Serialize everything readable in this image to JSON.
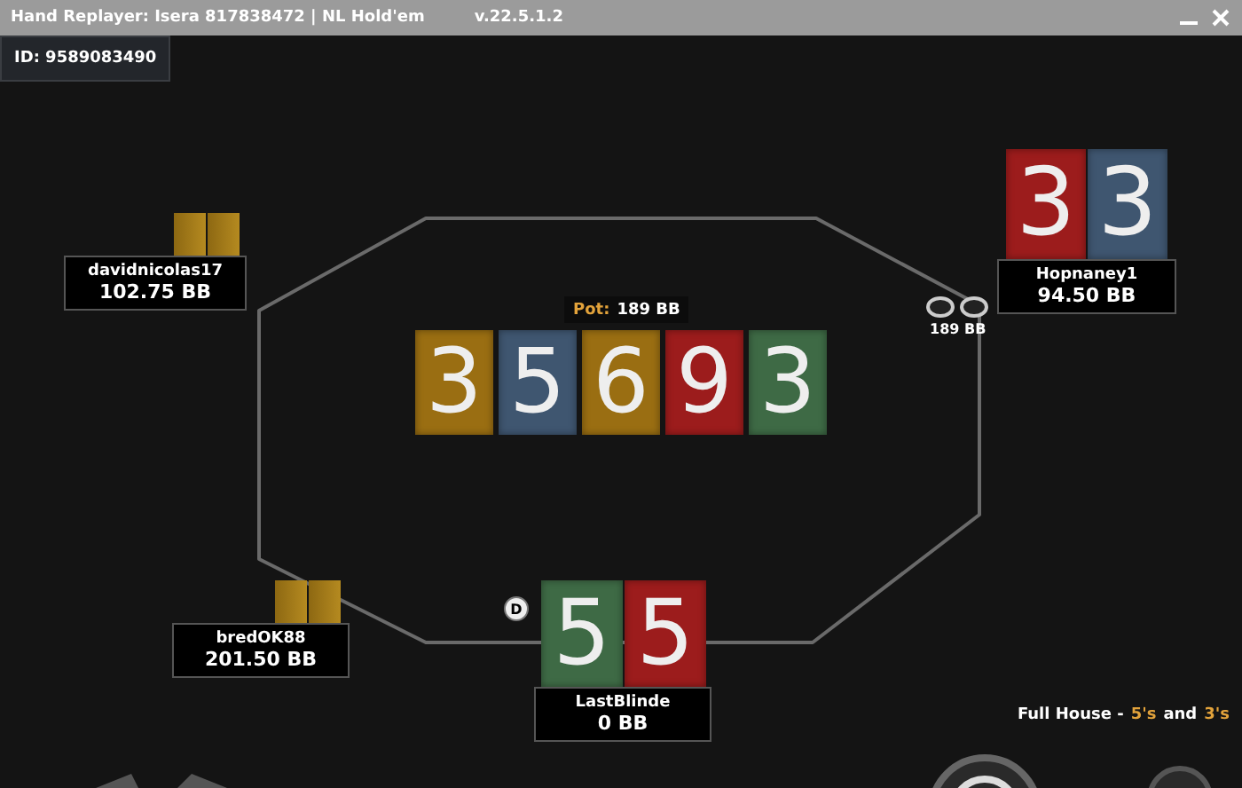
{
  "window": {
    "title": "Hand Replayer: Isera 817838472  |  NL Hold'em",
    "version": "v.22.5.1.2"
  },
  "hand_id": "ID: 9589083490",
  "pot": {
    "label": "Pot:",
    "amount": "189 BB"
  },
  "board": [
    {
      "rank": "3",
      "color": "#9a6e12"
    },
    {
      "rank": "5",
      "color": "#3f5670"
    },
    {
      "rank": "6",
      "color": "#9a6e12"
    },
    {
      "rank": "9",
      "color": "#9c1c1c"
    },
    {
      "rank": "3",
      "color": "#3e6a45"
    }
  ],
  "players": [
    {
      "name": "davidnicolas17",
      "stack": "102.75 BB",
      "dealer": false,
      "cards": [
        {
          "kind": "back"
        },
        {
          "kind": "back"
        }
      ]
    },
    {
      "name": "Hopnaney1",
      "stack": "94.50 BB",
      "dealer": false,
      "bet": "189 BB",
      "cards": [
        {
          "kind": "face",
          "rank": "3",
          "color": "#9c1c1c"
        },
        {
          "kind": "face",
          "rank": "3",
          "color": "#3f5670"
        }
      ]
    },
    {
      "name": "bredOK88",
      "stack": "201.50 BB",
      "dealer": false,
      "cards": [
        {
          "kind": "back"
        },
        {
          "kind": "back"
        }
      ]
    },
    {
      "name": "LastBlinde",
      "stack": "0 BB",
      "dealer": true,
      "dealer_label": "D",
      "cards": [
        {
          "kind": "face",
          "rank": "5",
          "color": "#3e6a45"
        },
        {
          "kind": "face",
          "rank": "5",
          "color": "#9c1c1c"
        }
      ]
    }
  ],
  "result": [
    {
      "text": "Full House -",
      "highlight": false
    },
    {
      "text": "5's",
      "highlight": true
    },
    {
      "text": "and",
      "highlight": false
    },
    {
      "text": "3's",
      "highlight": true
    }
  ]
}
